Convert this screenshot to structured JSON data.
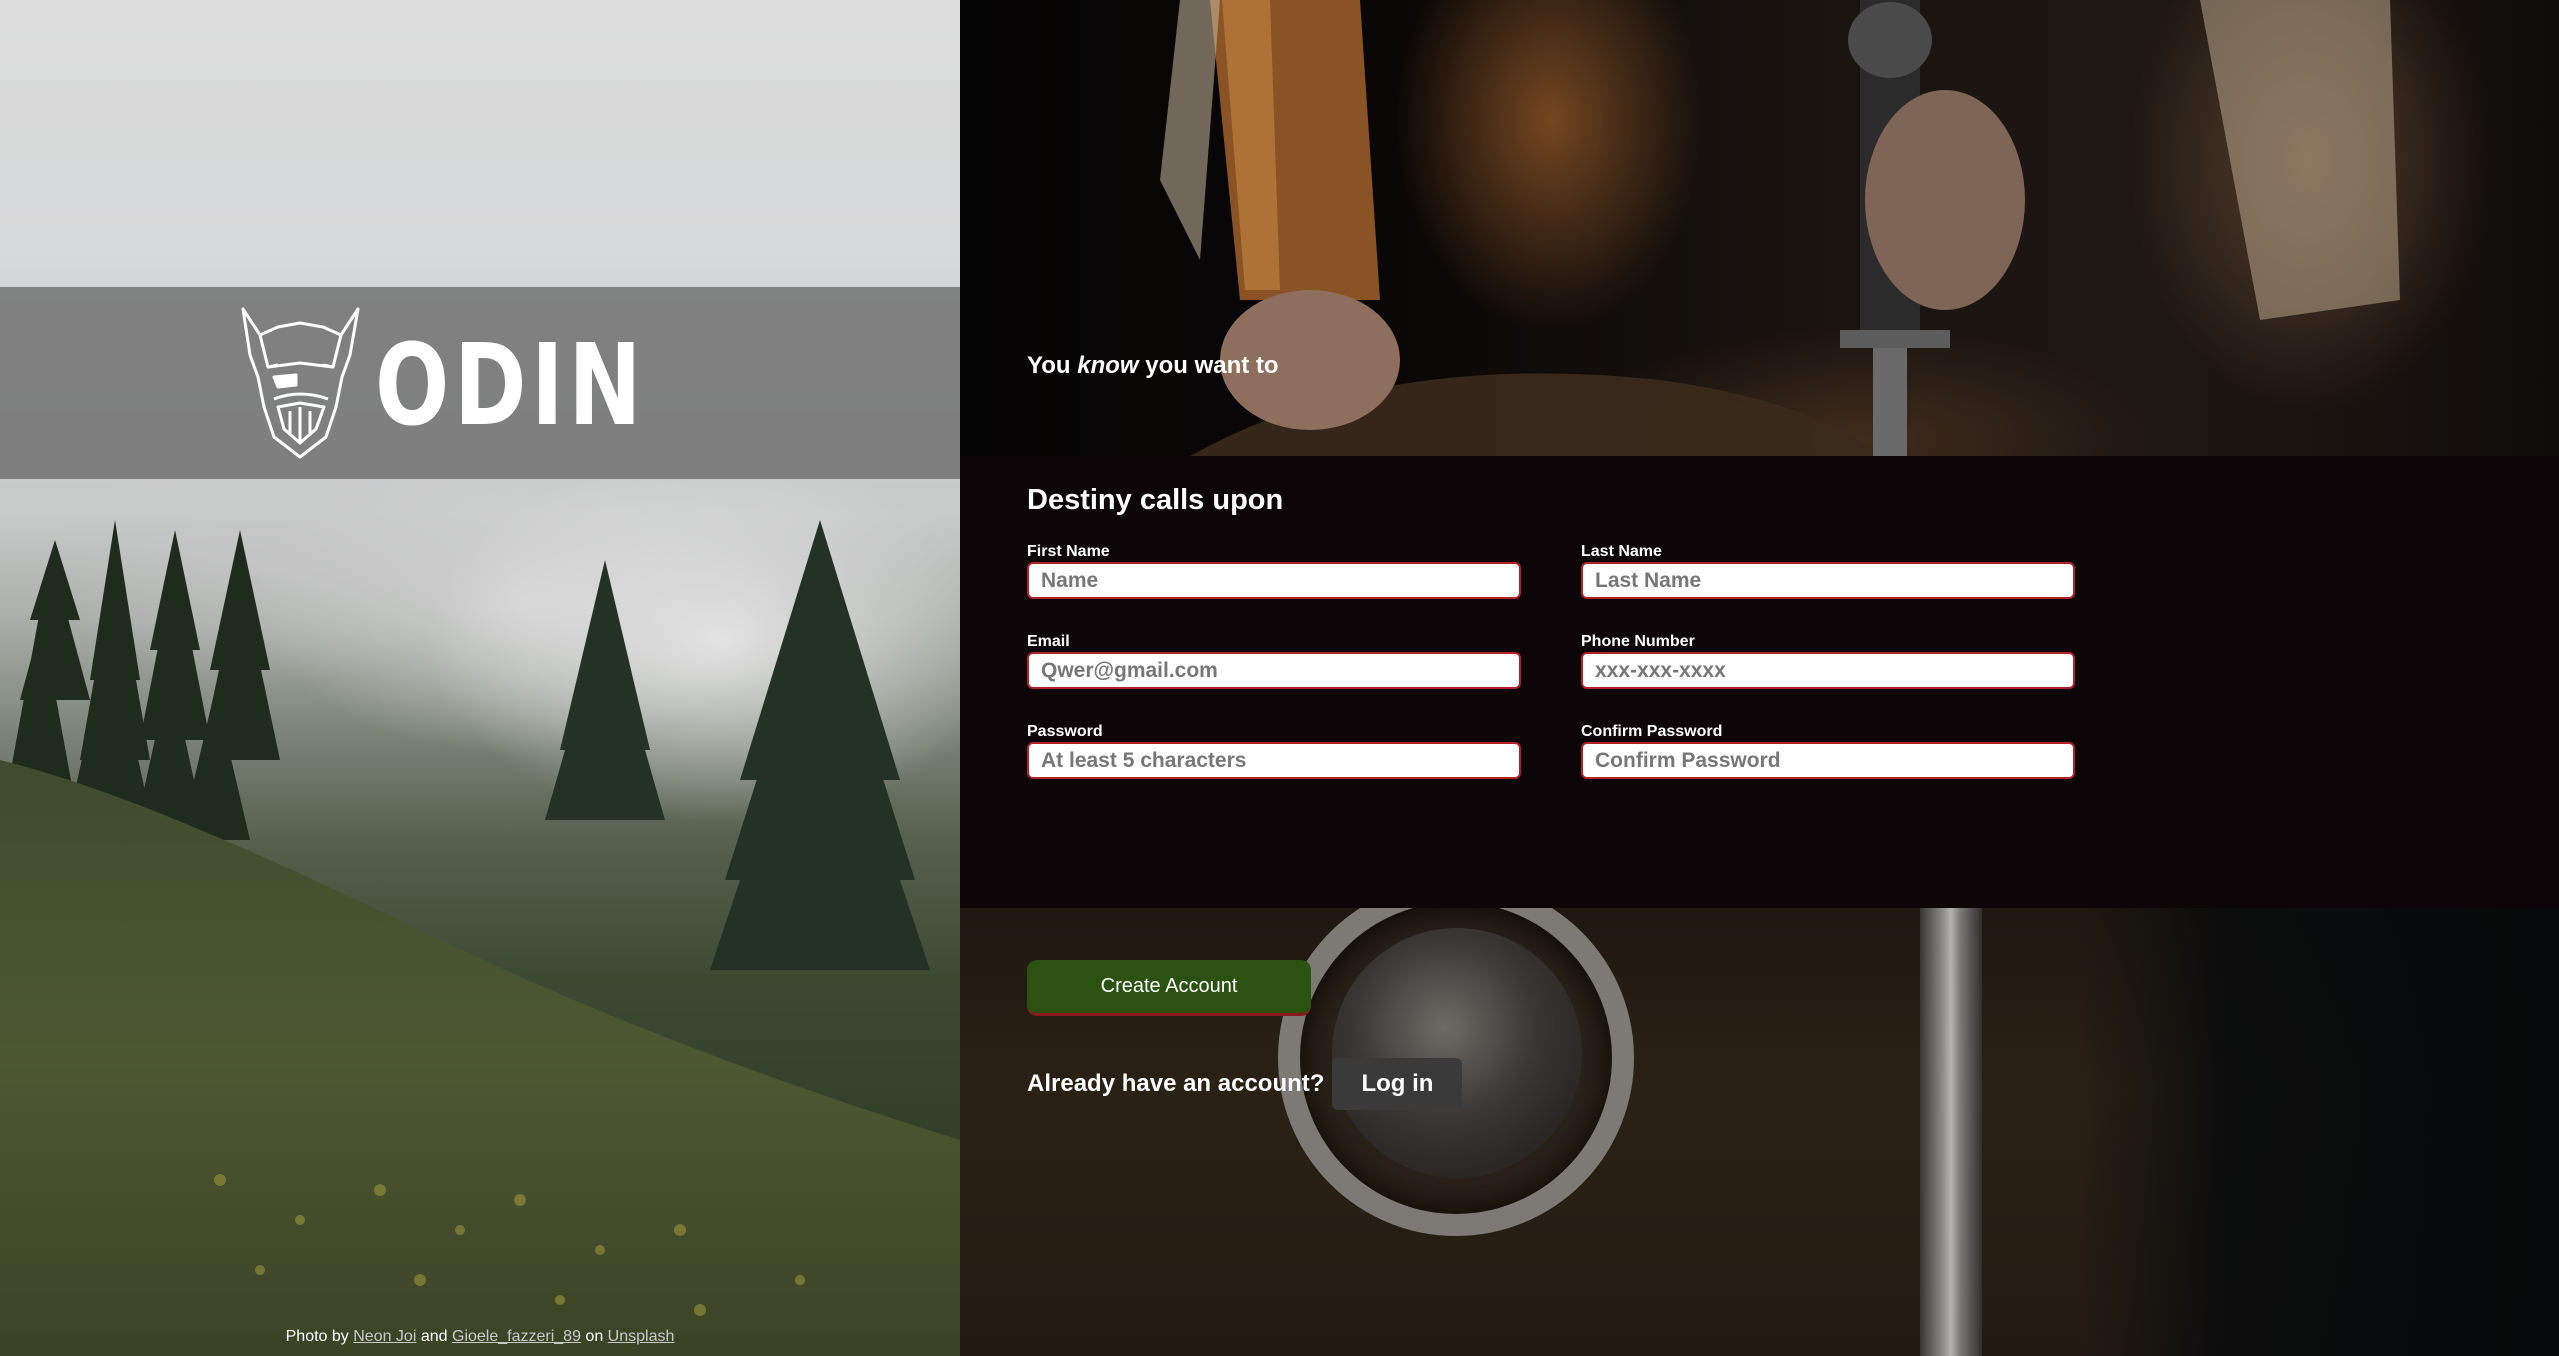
{
  "brand": {
    "name": "ODIN"
  },
  "left_panel": {
    "credit": {
      "prefix": "Photo by",
      "author1": "Neon Joi",
      "and": "and",
      "author2": "Gioele_fazzeri_89",
      "on": "on",
      "site": "Unsplash"
    }
  },
  "hero": {
    "tagline_before": "You",
    "tagline_emphasis": "know",
    "tagline_after": "you want to"
  },
  "form": {
    "title": "Destiny calls upon",
    "fields": {
      "first_name": {
        "label": "First Name",
        "placeholder": "Name"
      },
      "last_name": {
        "label": "Last Name",
        "placeholder": "Last Name"
      },
      "email": {
        "label": "Email",
        "placeholder": "Qwer@gmail.com"
      },
      "phone": {
        "label": "Phone Number",
        "placeholder": "xxx-xxx-xxxx"
      },
      "password": {
        "label": "Password",
        "placeholder": "At least 5 characters"
      },
      "confirm_password": {
        "label": "Confirm Password",
        "placeholder": "Confirm Password"
      }
    }
  },
  "actions": {
    "create_account": "Create Account",
    "already_have_account": "Already have an account?",
    "log_in": "Log in"
  },
  "colors": {
    "create_button": "#2b5211",
    "input_border": "#b3202a",
    "form_background": "#0c0608"
  }
}
